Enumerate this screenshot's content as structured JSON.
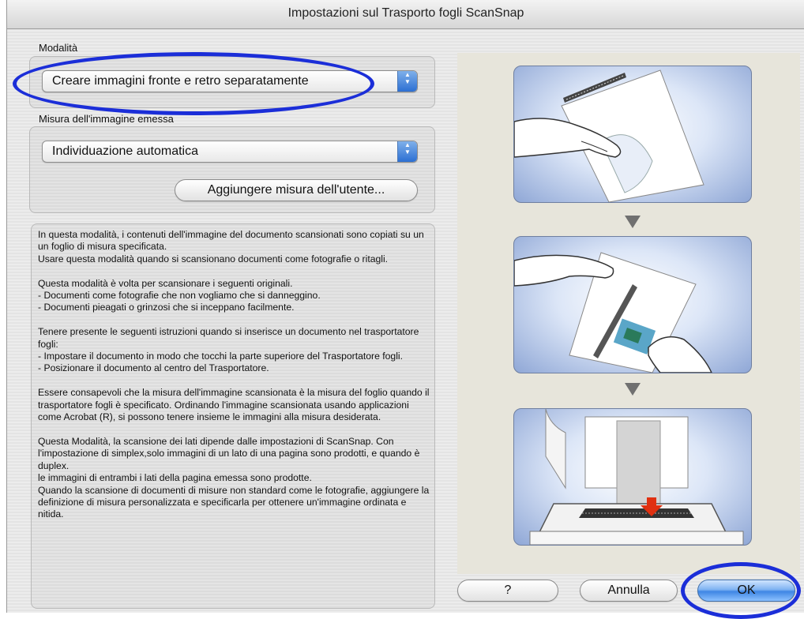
{
  "window": {
    "title": "Impostazioni sul Trasporto fogli ScanSnap"
  },
  "mode": {
    "label": "Modalità",
    "selected": "Creare immagini fronte e retro separatamente"
  },
  "output_size": {
    "label": "Misura dell'immagine emessa",
    "selected": "Individuazione automatica",
    "add_button": "Aggiungere misura dell'utente..."
  },
  "description": "In questa modalità, i contenuti dell'immagine del documento scansionati sono copiati su un un foglio di misura specificata.\nUsare questa modalità quando si scansionano documenti come fotografie o ritagli.\n\nQuesta modalità è volta per scansionare i seguenti originali.\n - Documenti come fotografie che non vogliamo che si danneggino.\n - Documenti pieagati o grinzosi che si inceppano facilmente.\n\nTenere presente le seguenti istruzioni quando si inserisce un documento nel trasportatore fogli:\n - Impostare il documento in modo che tocchi la parte superiore del Trasportatore fogli.\n - Posizionare il documento al centro del Trasportatore.\n\nEssere consapevoli che la misura dell'immagine scansionata è la misura del foglio quando il trasportatore fogli è specificato. Ordinando l'immagine scansionata usando applicazioni come  Acrobat (R), si possono tenere insieme le immagini alla misura desiderata.\n\nQuesta Modalità, la scansione dei lati dipende dalle impostazioni di ScanSnap. Con l'impostazione di simplex,solo immagini di un lato di una pagina sono prodotti, e quando è duplex.\nle immagini di entrambi i lati della pagina emessa sono prodotte.\nQuando la scansione di documenti di misure non standard come le fotografie, aggiungere la definizione di misura personalizzata e specificarla per ottenere un'immagine ordinata e nitida.",
  "buttons": {
    "help": "?",
    "cancel": "Annulla",
    "ok": "OK"
  },
  "colors": {
    "highlight_ellipse": "#1b2ed8",
    "default_button": "#3f86e4"
  }
}
